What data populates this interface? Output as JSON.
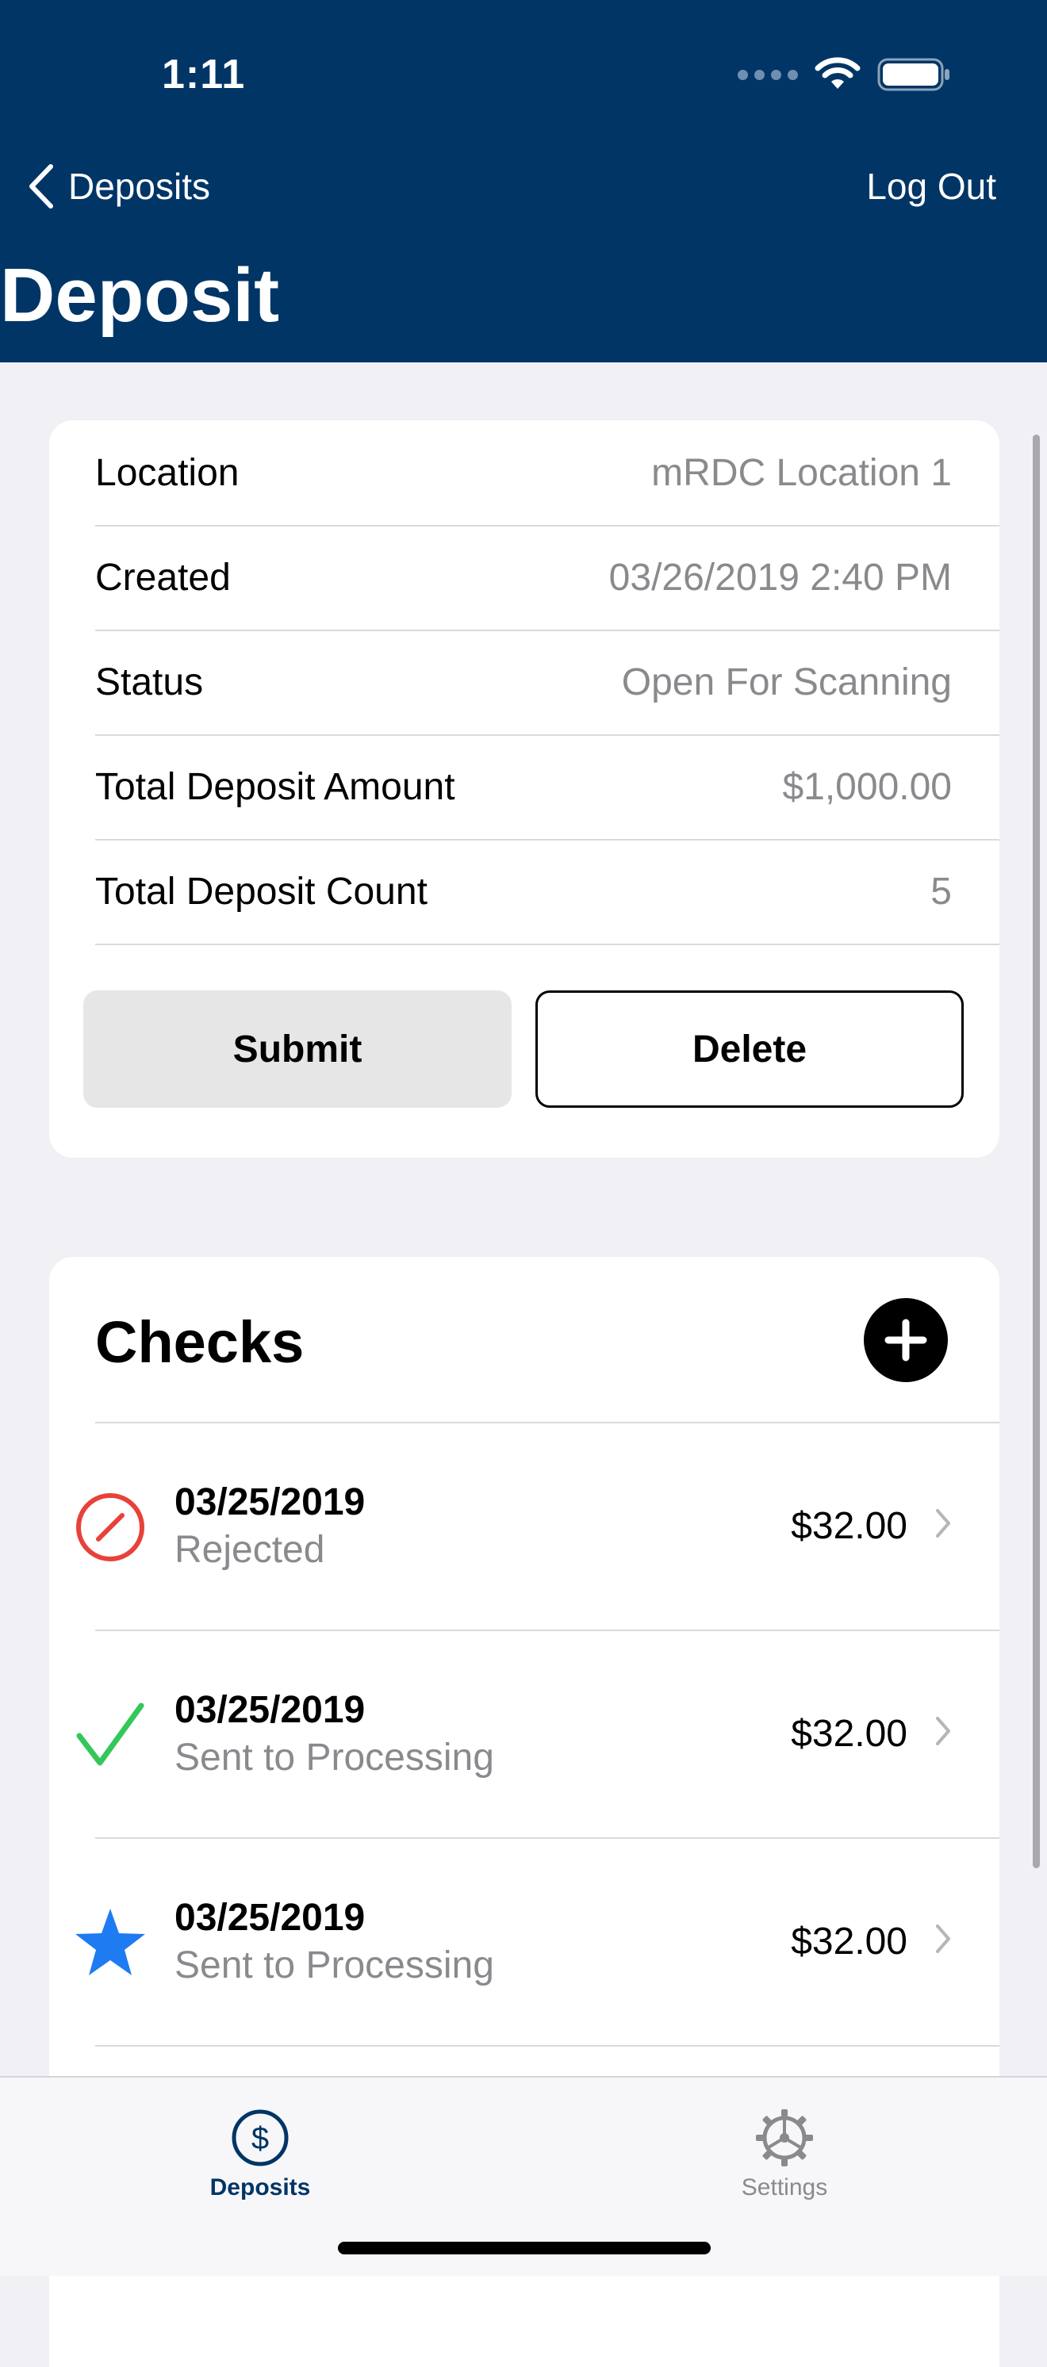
{
  "status_bar": {
    "time": "1:11"
  },
  "nav": {
    "back_label": "Deposits",
    "logout_label": "Log Out",
    "title": "Deposit"
  },
  "details": {
    "rows": [
      {
        "label": "Location",
        "value": "mRDC Location 1"
      },
      {
        "label": "Created",
        "value": "03/26/2019 2:40 PM"
      },
      {
        "label": "Status",
        "value": "Open For Scanning"
      },
      {
        "label": "Total Deposit Amount",
        "value": "$1,000.00"
      },
      {
        "label": "Total Deposit Count",
        "value": "5"
      }
    ],
    "submit_label": "Submit",
    "delete_label": "Delete"
  },
  "checks": {
    "title": "Checks",
    "items": [
      {
        "date": "03/25/2019",
        "status": "Rejected",
        "amount": "$32.00",
        "icon": "rejected-icon"
      },
      {
        "date": "03/25/2019",
        "status": "Sent to Processing",
        "amount": "$32.00",
        "icon": "checkmark-icon"
      },
      {
        "date": "03/25/2019",
        "status": "Sent to Processing",
        "amount": "$32.00",
        "icon": "star-icon"
      }
    ]
  },
  "tabbar": {
    "deposits_label": "Deposits",
    "settings_label": "Settings"
  },
  "colors": {
    "header_bg": "#003566",
    "rejected": "#E8413A",
    "processed": "#34C759",
    "star": "#1E7BF2"
  }
}
